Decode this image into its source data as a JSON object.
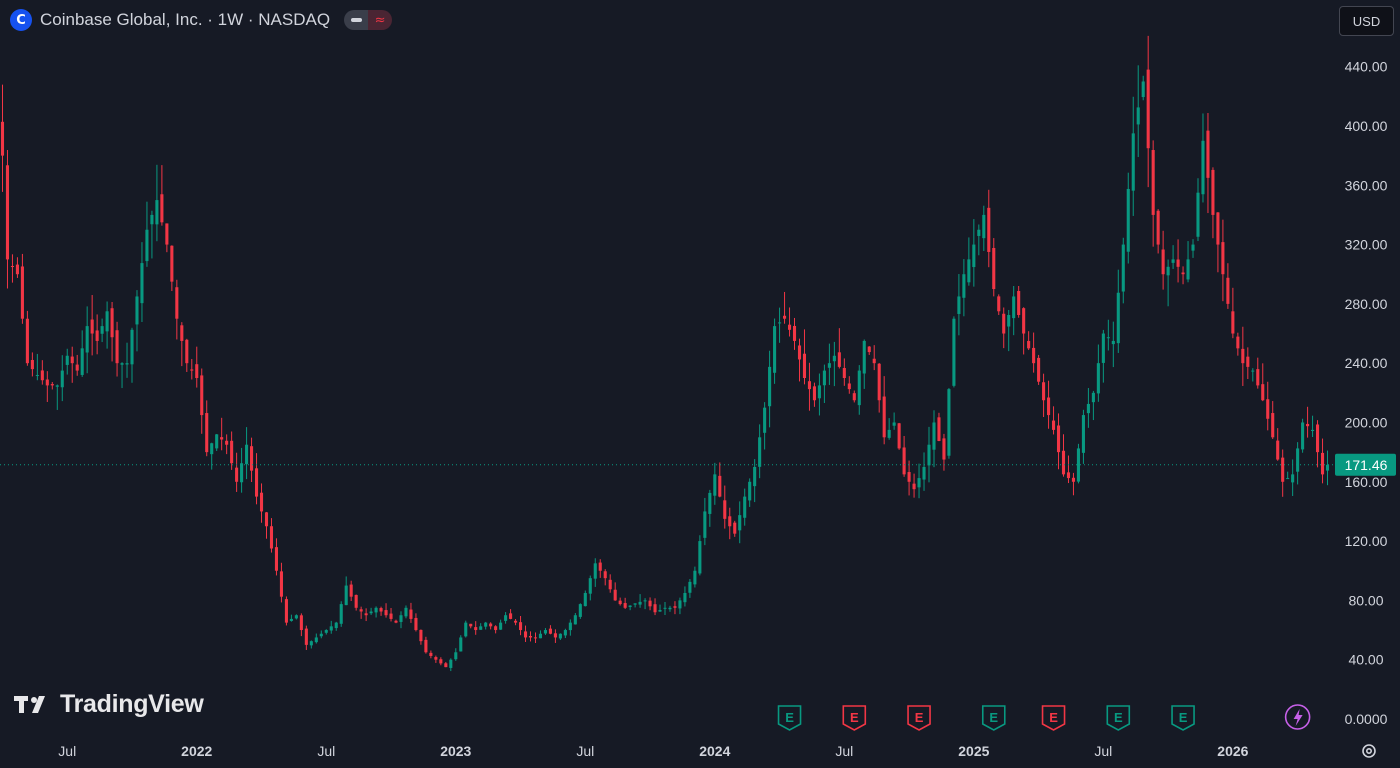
{
  "header": {
    "symbol_logo_letter": "C",
    "title": "Coinbase Global, Inc. · 1W · NASDAQ",
    "pill_right_glyph": "≈",
    "currency": "USD"
  },
  "branding": {
    "logo_text": "TradingView"
  },
  "colors": {
    "background": "#161a25",
    "up": "#089981",
    "down": "#f23645",
    "axis_text": "#d1d4dc",
    "last_price_bg": "#089981"
  },
  "chart_data": {
    "type": "candlestick",
    "symbol": "COIN",
    "interval": "1W",
    "exchange": "NASDAQ",
    "ylim": [
      0,
      460
    ],
    "y_ticks": [
      0,
      40,
      80,
      120,
      160,
      200,
      240,
      280,
      320,
      360,
      400,
      440
    ],
    "y_tick_labels": [
      "0.0000",
      "40.00",
      "80.00",
      "120.00",
      "160.00",
      "200.00",
      "240.00",
      "280.00",
      "320.00",
      "360.00",
      "400.00",
      "440.00"
    ],
    "x_tick_labels": [
      "Jul",
      "2022",
      "Jul",
      "2023",
      "Jul",
      "2024",
      "Jul",
      "2025",
      "Jul",
      "2026"
    ],
    "x_tick_weeks": [
      13,
      39,
      65,
      91,
      117,
      143,
      169,
      195,
      221,
      247
    ],
    "last_price": 171.46,
    "last_price_label": "171.46",
    "earnings": [
      {
        "week": 158,
        "label": "E",
        "type": "beat"
      },
      {
        "week": 171,
        "label": "E",
        "type": "miss"
      },
      {
        "week": 184,
        "label": "E",
        "type": "miss"
      },
      {
        "week": 199,
        "label": "E",
        "type": "beat"
      },
      {
        "week": 211,
        "label": "E",
        "type": "miss"
      },
      {
        "week": 224,
        "label": "E",
        "type": "beat"
      },
      {
        "week": 237,
        "label": "E",
        "type": "beat"
      }
    ],
    "event_marker": {
      "week": 260,
      "icon": "lightning-icon"
    },
    "anchors": [
      [
        0,
        380
      ],
      [
        1,
        310
      ],
      [
        3,
        300
      ],
      [
        5,
        240
      ],
      [
        7,
        232
      ],
      [
        9,
        225
      ],
      [
        11,
        225
      ],
      [
        13,
        245
      ],
      [
        15,
        235
      ],
      [
        17,
        265
      ],
      [
        19,
        255
      ],
      [
        21,
        275
      ],
      [
        23,
        240
      ],
      [
        25,
        240
      ],
      [
        27,
        285
      ],
      [
        29,
        330
      ],
      [
        31,
        350
      ],
      [
        33,
        320
      ],
      [
        35,
        270
      ],
      [
        37,
        240
      ],
      [
        39,
        230
      ],
      [
        41,
        180
      ],
      [
        43,
        192
      ],
      [
        45,
        185
      ],
      [
        47,
        160
      ],
      [
        49,
        185
      ],
      [
        51,
        150
      ],
      [
        53,
        130
      ],
      [
        55,
        100
      ],
      [
        57,
        65
      ],
      [
        59,
        70
      ],
      [
        61,
        50
      ],
      [
        63,
        55
      ],
      [
        65,
        60
      ],
      [
        67,
        65
      ],
      [
        69,
        90
      ],
      [
        71,
        75
      ],
      [
        73,
        70
      ],
      [
        75,
        75
      ],
      [
        77,
        70
      ],
      [
        79,
        65
      ],
      [
        81,
        75
      ],
      [
        83,
        60
      ],
      [
        85,
        45
      ],
      [
        87,
        40
      ],
      [
        89,
        35
      ],
      [
        91,
        45
      ],
      [
        93,
        65
      ],
      [
        95,
        60
      ],
      [
        97,
        65
      ],
      [
        99,
        60
      ],
      [
        101,
        70
      ],
      [
        103,
        65
      ],
      [
        105,
        55
      ],
      [
        107,
        55
      ],
      [
        109,
        60
      ],
      [
        111,
        55
      ],
      [
        113,
        60
      ],
      [
        115,
        70
      ],
      [
        117,
        85
      ],
      [
        119,
        105
      ],
      [
        121,
        95
      ],
      [
        123,
        80
      ],
      [
        125,
        75
      ],
      [
        127,
        78
      ],
      [
        129,
        80
      ],
      [
        131,
        72
      ],
      [
        133,
        75
      ],
      [
        135,
        75
      ],
      [
        137,
        85
      ],
      [
        139,
        100
      ],
      [
        141,
        140
      ],
      [
        143,
        165
      ],
      [
        145,
        135
      ],
      [
        147,
        125
      ],
      [
        149,
        150
      ],
      [
        151,
        170
      ],
      [
        153,
        210
      ],
      [
        155,
        265
      ],
      [
        157,
        270
      ],
      [
        159,
        255
      ],
      [
        161,
        230
      ],
      [
        163,
        215
      ],
      [
        165,
        235
      ],
      [
        167,
        245
      ],
      [
        169,
        230
      ],
      [
        171,
        215
      ],
      [
        173,
        255
      ],
      [
        175,
        240
      ],
      [
        177,
        190
      ],
      [
        179,
        200
      ],
      [
        181,
        165
      ],
      [
        183,
        155
      ],
      [
        185,
        170
      ],
      [
        187,
        200
      ],
      [
        189,
        175
      ],
      [
        191,
        270
      ],
      [
        193,
        300
      ],
      [
        195,
        320
      ],
      [
        197,
        340
      ],
      [
        199,
        290
      ],
      [
        201,
        260
      ],
      [
        203,
        285
      ],
      [
        205,
        260
      ],
      [
        207,
        240
      ],
      [
        209,
        215
      ],
      [
        211,
        195
      ],
      [
        213,
        165
      ],
      [
        215,
        160
      ],
      [
        217,
        205
      ],
      [
        219,
        220
      ],
      [
        221,
        260
      ],
      [
        223,
        255
      ],
      [
        225,
        320
      ],
      [
        227,
        395
      ],
      [
        229,
        430
      ],
      [
        231,
        340
      ],
      [
        233,
        300
      ],
      [
        235,
        310
      ],
      [
        237,
        300
      ],
      [
        239,
        320
      ],
      [
        241,
        390
      ],
      [
        243,
        340
      ],
      [
        245,
        300
      ],
      [
        247,
        260
      ],
      [
        249,
        240
      ],
      [
        251,
        235
      ],
      [
        253,
        215
      ],
      [
        255,
        190
      ],
      [
        257,
        160
      ],
      [
        259,
        165
      ],
      [
        261,
        200
      ],
      [
        263,
        195
      ],
      [
        265,
        165
      ],
      [
        266,
        171.46
      ]
    ]
  }
}
